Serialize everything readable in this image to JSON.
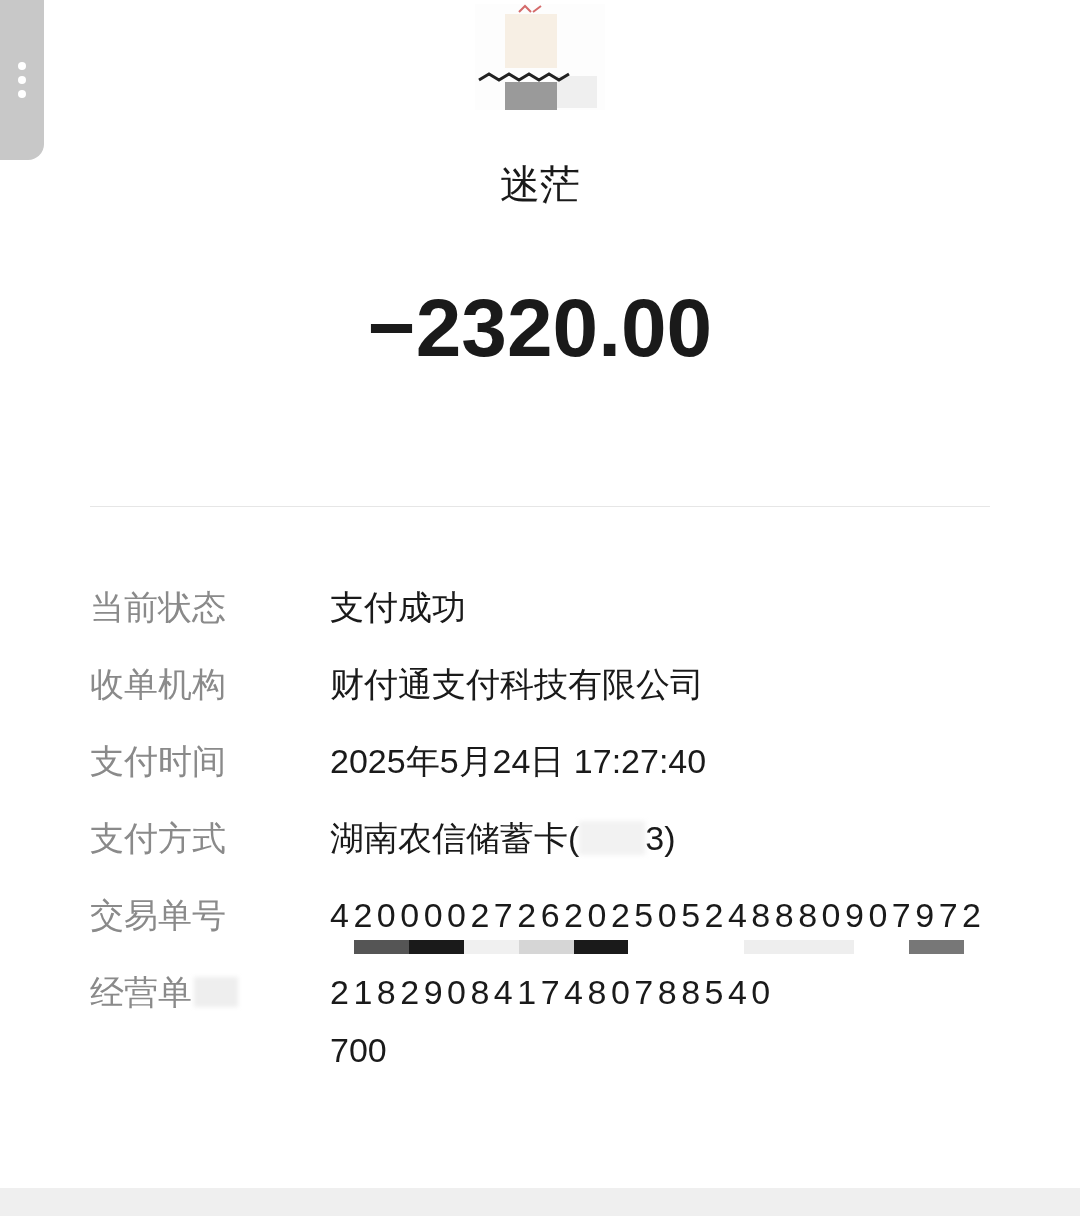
{
  "payee": {
    "name": "迷茫"
  },
  "amount": "−2320.00",
  "details": [
    {
      "label": "当前状态",
      "value": "支付成功",
      "kind": "plain"
    },
    {
      "label": "收单机构",
      "value": "财付通支付科技有限公司",
      "kind": "plain"
    },
    {
      "label": "支付时间",
      "value": "2025年5月24日 17:27:40",
      "kind": "plain"
    },
    {
      "label": "支付方式",
      "value": "湖南农信储蓄卡(",
      "suffix": "3)",
      "kind": "masked"
    },
    {
      "label": "交易单号",
      "value": "4200002726202505248880907972",
      "kind": "covered"
    },
    {
      "label": "经营单",
      "value": "2182908417480788540",
      "continuation": "700",
      "kind": "clipped"
    }
  ]
}
